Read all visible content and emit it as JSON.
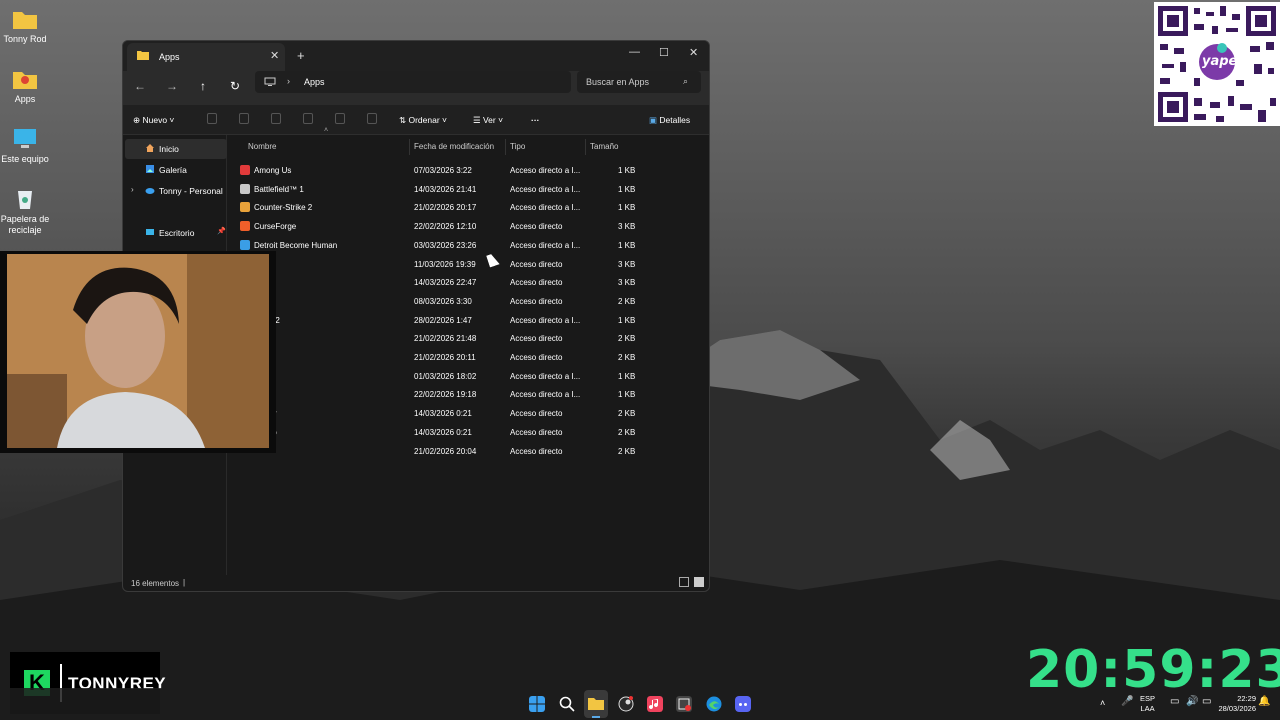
{
  "desktop": {
    "icons": [
      {
        "label": "Tonny Rod"
      },
      {
        "label": "Apps"
      },
      {
        "label": "Este equipo"
      },
      {
        "label": "Papelera de reciclaje"
      }
    ]
  },
  "explorer": {
    "tab_title": "Apps",
    "address": "Apps",
    "search_placeholder": "Buscar en Apps",
    "toolbar": {
      "new_label": "Nuevo",
      "sort_label": "Ordenar",
      "view_label": "Ver",
      "details_label": "Detalles"
    },
    "nav": [
      {
        "label": "Inicio"
      },
      {
        "label": "Galería"
      },
      {
        "label": "Tonny - Personal"
      },
      {
        "label": "Escritorio"
      }
    ],
    "columns": {
      "name": "Nombre",
      "modified": "Fecha de modificación",
      "type": "Tipo",
      "size": "Tamaño"
    },
    "rows": [
      {
        "name": "Among Us",
        "date": "07/03/2026 3:22",
        "type": "Acceso directo a I...",
        "size": "1 KB"
      },
      {
        "name": "Battlefield™ 1",
        "date": "14/03/2026 21:41",
        "type": "Acceso directo a I...",
        "size": "1 KB"
      },
      {
        "name": "Counter-Strike 2",
        "date": "21/02/2026 20:17",
        "type": "Acceso directo a I...",
        "size": "1 KB"
      },
      {
        "name": "CurseForge",
        "date": "22/02/2026 12:10",
        "type": "Acceso directo",
        "size": "3 KB"
      },
      {
        "name": "Detroit Become Human",
        "date": "03/03/2026 23:26",
        "type": "Acceso directo a I...",
        "size": "1 KB"
      },
      {
        "name": "d",
        "date": "11/03/2026 19:39",
        "type": "Acceso directo",
        "size": "3 KB"
      },
      {
        "name": "",
        "date": "14/03/2026 22:47",
        "type": "Acceso directo",
        "size": "3 KB"
      },
      {
        "name": "lio 21",
        "date": "08/03/2026 3:30",
        "type": "Acceso directo",
        "size": "2 KB"
      },
      {
        "name": "Dead 2",
        "date": "28/02/2026 1:47",
        "type": "Acceso directo a I...",
        "size": "1 KB"
      },
      {
        "name": "App",
        "date": "21/02/2026 21:48",
        "type": "Acceso directo",
        "size": "2 KB"
      },
      {
        "name": "udio",
        "date": "21/02/2026 20:11",
        "type": "Acceso directo",
        "size": "2 KB"
      },
      {
        "name": "atch®",
        "date": "01/03/2026 18:02",
        "type": "Acceso directo a I...",
        "size": "1 KB"
      },
      {
        "name": ".",
        "date": "22/02/2026 19:18",
        "type": "Acceso directo a I...",
        "size": "1 KB"
      },
      {
        "name": "Player",
        "date": "14/03/2026 0:21",
        "type": "Acceso directo",
        "size": "2 KB"
      },
      {
        "name": "Studio",
        "date": "14/03/2026 0:21",
        "type": "Acceso directo",
        "size": "2 KB"
      },
      {
        "name": "",
        "date": "21/02/2026 20:04",
        "type": "Acceso directo",
        "size": "2 KB"
      }
    ],
    "status": "16 elementos"
  },
  "overlay": {
    "brand": "TONNYREY",
    "brand_letter": "K",
    "timer": "20:59:23",
    "qr_label": "yape"
  },
  "taskbar": {
    "lang_top": "ESP",
    "lang_bottom": "LAA",
    "time": "22:29",
    "date": "28/03/2026"
  }
}
